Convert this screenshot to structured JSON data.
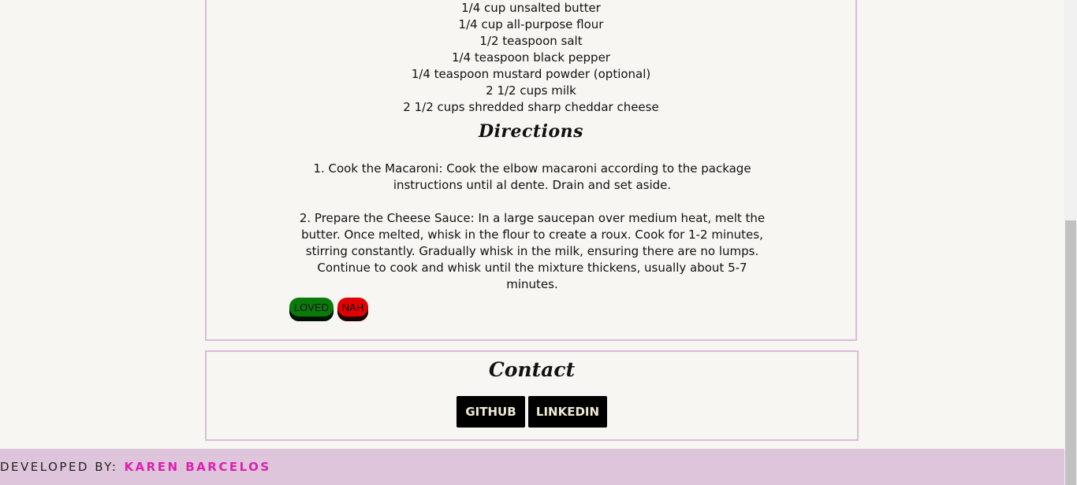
{
  "ingredients": [
    "1/4 cup unsalted butter",
    "1/4 cup all-purpose flour",
    "1/2 teaspoon salt",
    "1/4 teaspoon black pepper",
    "1/4 teaspoon mustard powder (optional)",
    "2 1/2 cups milk",
    "2 1/2 cups shredded sharp cheddar cheese"
  ],
  "directions": {
    "heading": "Directions",
    "steps": [
      "1. Cook the Macaroni: Cook the elbow macaroni according to the package instructions until al dente. Drain and set aside.",
      "2. Prepare the Cheese Sauce: In a large saucepan over medium heat, melt the butter. Once melted, whisk in the flour to create a roux. Cook for 1-2 minutes, stirring constantly. Gradually whisk in the milk, ensuring there are no lumps. Continue to cook and whisk until the mixture thickens, usually about 5-7 minutes."
    ]
  },
  "votes": {
    "loved_label": "LOVED",
    "nah_label": "NAH"
  },
  "contact": {
    "heading": "Contact",
    "github_label": "GITHUB",
    "linkedin_label": "LINKEDIN"
  },
  "footer": {
    "prefix": "DEVELOPED BY:",
    "author": "KAREN BARCELOS"
  },
  "colors": {
    "loved": "#0a7a0a",
    "nah": "#e10000",
    "border": "#dcbcd8",
    "footer_bg": "#dfc5db",
    "author": "#e01fb0"
  }
}
